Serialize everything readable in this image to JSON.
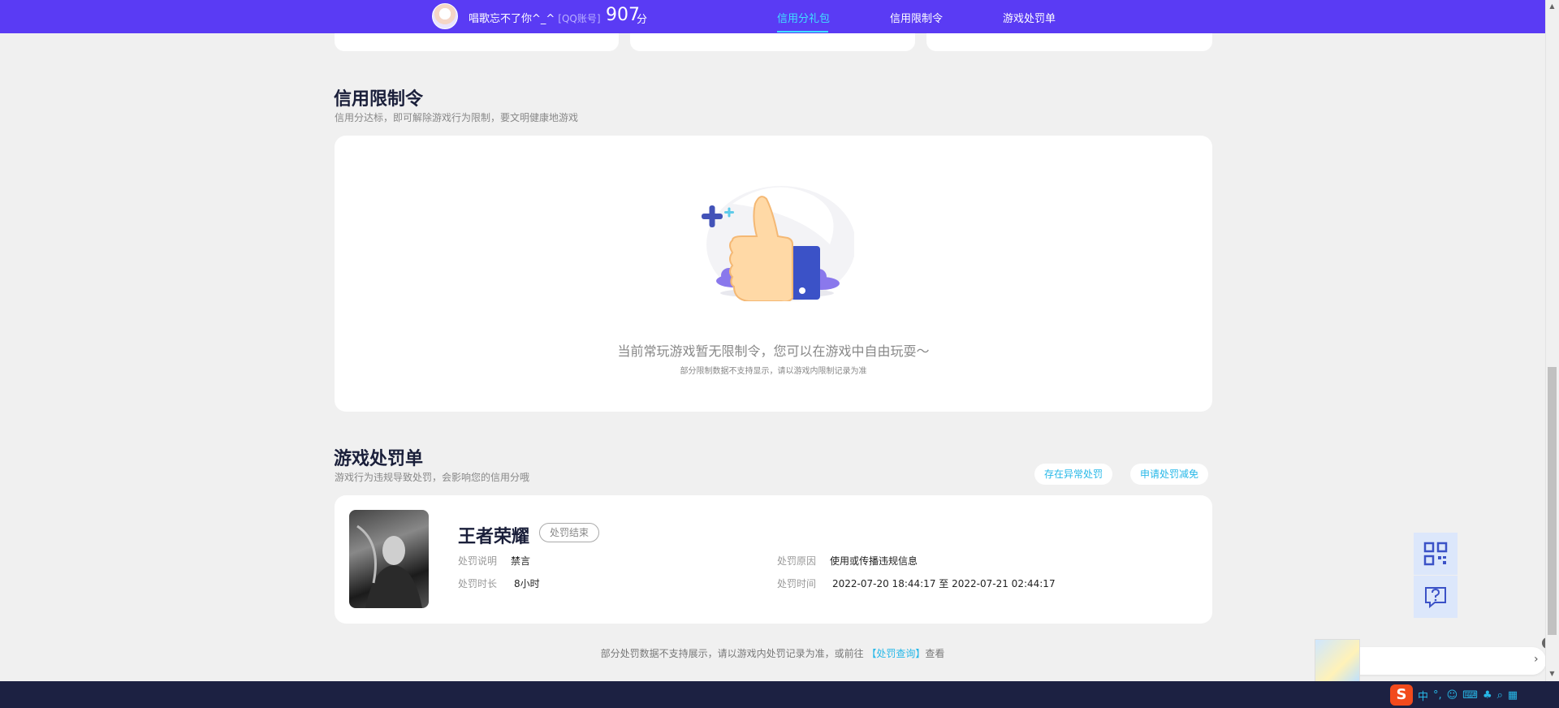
{
  "header": {
    "user_name": "唱歌忘不了你^_^",
    "account_type": "[QQ账号]",
    "score": "907",
    "score_unit": "分",
    "tabs": [
      "信用分礼包",
      "信用限制令",
      "游戏处罚单"
    ],
    "active_tab": 0
  },
  "restriction": {
    "title": "信用限制令",
    "subtitle": "信用分达标，即可解除游戏行为限制，要文明健康地游戏",
    "empty_message": "当前常玩游戏暂无限制令，您可以在游戏中自由玩耍～",
    "empty_note": "部分限制数据不支持显示，请以游戏内限制记录为准"
  },
  "penalty": {
    "title": "游戏处罚单",
    "subtitle": "游戏行为违规导致处罚，会影响您的信用分哦",
    "btn_abnormal": "存在异常处罚",
    "btn_appeal": "申请处罚减免",
    "record": {
      "game_name": "王者荣耀",
      "status": "处罚结束",
      "desc_label": "处罚说明",
      "desc_value": "禁言",
      "duration_label": "处罚时长",
      "duration_value": "8小时",
      "reason_label": "处罚原因",
      "reason_value": "使用或传播违规信息",
      "time_label": "处罚时间",
      "time_start": "2022-07-20 18:44:17",
      "time_sep": "至",
      "time_end": "2022-07-21 02:44:17"
    },
    "footer_prefix": "部分处罚数据不支持展示，请以游戏内处罚记录为准，或前往",
    "footer_link": "【处罚查询】",
    "footer_suffix": "查看"
  },
  "taskbar": {
    "ime_lang": "中",
    "ime_punct": "°,"
  },
  "colors": {
    "brand": "#5a3bf4",
    "accent": "#3ee0ff",
    "link": "#27b8e8",
    "footer_bar": "#1c2142"
  }
}
